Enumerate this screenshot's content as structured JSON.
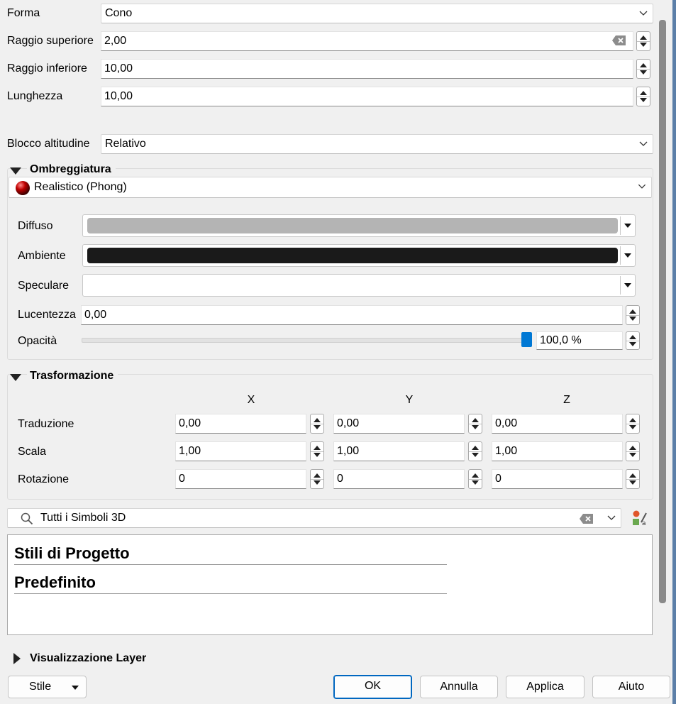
{
  "geometry": {
    "shape_label": "Forma",
    "shape_value": "Cono",
    "top_radius_label": "Raggio superiore",
    "top_radius_value": "2,00",
    "bottom_radius_label": "Raggio inferiore",
    "bottom_radius_value": "10,00",
    "length_label": "Lunghezza",
    "length_value": "10,00"
  },
  "altitude": {
    "label": "Blocco altitudine",
    "value": "Relativo"
  },
  "shading": {
    "title": "Ombreggiatura",
    "model": "Realistico (Phong)",
    "diffuse_label": "Diffuso",
    "diffuse_color": "#b4b4b4",
    "ambient_label": "Ambiente",
    "ambient_color": "#1a1a1a",
    "specular_label": "Speculare",
    "specular_color": "#ffffff",
    "shininess_label": "Lucentezza",
    "shininess_value": "0,00",
    "opacity_label": "Opacità",
    "opacity_value": "100,0 %",
    "opacity_fraction": 1.0
  },
  "transform": {
    "title": "Trasformazione",
    "axes": [
      "X",
      "Y",
      "Z"
    ],
    "translation_label": "Traduzione",
    "translation": [
      "0,00",
      "0,00",
      "0,00"
    ],
    "scale_label": "Scala",
    "scale": [
      "1,00",
      "1,00",
      "1,00"
    ],
    "rotation_label": "Rotazione",
    "rotation": [
      "0",
      "0",
      "0"
    ]
  },
  "library": {
    "filter_value": "Tutti i Simboli 3D",
    "groups": [
      "Stili di Progetto",
      "Predefinito"
    ]
  },
  "layer_rendering": {
    "title": "Visualizzazione Layer"
  },
  "buttons": {
    "style": "Stile",
    "ok": "OK",
    "cancel": "Annulla",
    "apply": "Applica",
    "help": "Aiuto"
  },
  "colors": {
    "accent": "#0078d4",
    "background": "#f0f0f0"
  }
}
